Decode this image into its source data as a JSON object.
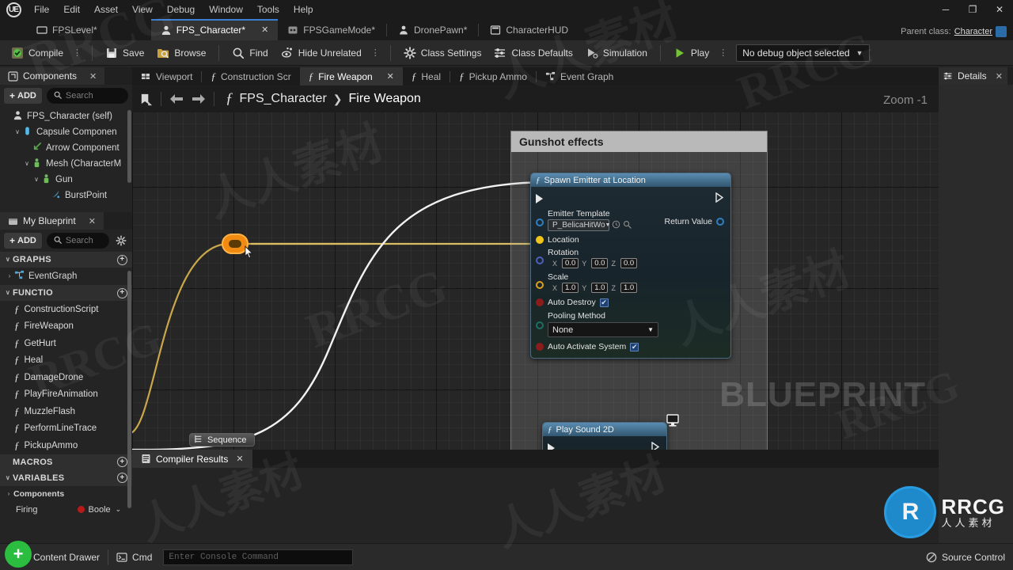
{
  "app": {
    "logo_text": "UE",
    "menu": [
      "File",
      "Edit",
      "Asset",
      "View",
      "Debug",
      "Window",
      "Tools",
      "Help"
    ],
    "window_controls": {
      "minimize": "─",
      "maximize": "❐",
      "close": "✕"
    }
  },
  "asset_tabs": [
    {
      "label": "FPSLevel*",
      "icon": "level-icon",
      "active": false,
      "closeable": false
    },
    {
      "label": "FPS_Character*",
      "icon": "character-icon",
      "active": true,
      "closeable": true,
      "close": "✕"
    },
    {
      "label": "FPSGameMode*",
      "icon": "gamemode-icon",
      "active": false,
      "closeable": false
    },
    {
      "label": "DronePawn*",
      "icon": "pawn-icon",
      "active": false,
      "closeable": false
    },
    {
      "label": "CharacterHUD",
      "icon": "hud-icon",
      "active": false,
      "closeable": false
    }
  ],
  "parent_class": {
    "label": "Parent class:",
    "value": "Character"
  },
  "toolbar": {
    "compile": "Compile",
    "save": "Save",
    "browse": "Browse",
    "find": "Find",
    "hide_unrelated": "Hide Unrelated",
    "class_settings": "Class Settings",
    "class_defaults": "Class Defaults",
    "simulation": "Simulation",
    "play": "Play",
    "debug_object": "No debug object selected",
    "overflow_dots": "⋮"
  },
  "components_panel": {
    "tab_label": "Components",
    "tab_close": "✕",
    "add_label": "ADD",
    "search_placeholder": "Search",
    "tree": [
      {
        "label": "FPS_Character (self)",
        "indent": 0,
        "twisty": "",
        "icon": "character-icon"
      },
      {
        "label": "Capsule Componen",
        "indent": 1,
        "twisty": "∨",
        "icon": "capsule-icon"
      },
      {
        "label": "Arrow Component",
        "indent": 2,
        "twisty": "",
        "icon": "arrow-icon"
      },
      {
        "label": "Mesh (CharacterM",
        "indent": 2,
        "twisty": "∨",
        "icon": "mesh-icon"
      },
      {
        "label": "Gun",
        "indent": 3,
        "twisty": "∨",
        "icon": "mesh-icon"
      },
      {
        "label": "BurstPoint",
        "indent": 4,
        "twisty": "",
        "icon": "particle-icon"
      }
    ]
  },
  "myblueprint_panel": {
    "tab_label": "My Blueprint",
    "tab_close": "✕",
    "add_label": "ADD",
    "search_placeholder": "Search",
    "gear_icon": "⚙",
    "sections": {
      "graphs": {
        "title": "GRAPHS",
        "add": "+",
        "twisty": "∨",
        "items": [
          {
            "label": "EventGraph",
            "twisty": "›",
            "icon": "graph-icon"
          }
        ]
      },
      "functions": {
        "title": "FUNCTIO",
        "add": "+",
        "twisty": "∨",
        "items": [
          "ConstructionScript",
          "FireWeapon",
          "GetHurt",
          "Heal",
          "DamageDrone",
          "PlayFireAnimation",
          "MuzzleFlash",
          "PerformLineTrace",
          "PickupAmmo"
        ]
      },
      "macros": {
        "title": "MACROS",
        "add": "+",
        "twisty": ""
      },
      "variables": {
        "title": "VARIABLES",
        "add": "+",
        "twisty": "∨",
        "items": [
          {
            "label": "Components",
            "twisty": "›",
            "type": ""
          },
          {
            "label": "Firing",
            "twisty": "",
            "type": "Boole"
          }
        ]
      }
    }
  },
  "graph_tabs": [
    {
      "label": "Viewport",
      "icon": "viewport-icon",
      "active": false
    },
    {
      "label": "Construction Scr",
      "icon": "function-icon",
      "active": false
    },
    {
      "label": "Fire Weapon",
      "icon": "function-icon",
      "active": true,
      "close": "✕"
    },
    {
      "label": "Heal",
      "icon": "function-icon",
      "active": false
    },
    {
      "label": "Pickup Ammo",
      "icon": "function-icon",
      "active": false
    },
    {
      "label": "Event Graph",
      "icon": "graph-icon",
      "active": false
    }
  ],
  "graph": {
    "breadcrumb": {
      "root": "FPS_Character",
      "sep": "❯",
      "current": "Fire Weapon",
      "fn_icon": "function-icon"
    },
    "nav_back": "←",
    "nav_forward": "→",
    "bookmark_icon": "bookmark-icon",
    "zoom_label": "Zoom -1",
    "watermark": "BLUEPRINT",
    "comment": {
      "title": "Gunshot effects"
    },
    "nodes": {
      "spawn_emitter": {
        "title": "Spawn Emitter at Location",
        "pins": {
          "emitter_template_label": "Emitter Template",
          "emitter_template_value": "P_BelicaHitWo",
          "location_label": "Location",
          "rotation_label": "Rotation",
          "rotation": {
            "x_label": "X",
            "x": "0.0",
            "y_label": "Y",
            "y": "0.0",
            "z_label": "Z",
            "z": "0.0"
          },
          "scale_label": "Scale",
          "scale": {
            "x_label": "X",
            "x": "1.0",
            "y_label": "Y",
            "y": "1.0",
            "z_label": "Z",
            "z": "1.0"
          },
          "auto_destroy_label": "Auto Destroy",
          "auto_destroy_checked": "✔",
          "pooling_method_label": "Pooling Method",
          "pooling_method_value": "None",
          "auto_activate_label": "Auto Activate System",
          "auto_activate_checked": "✔",
          "return_value_label": "Return Value"
        }
      },
      "sequence": {
        "title": "Sequence"
      },
      "play_sound": {
        "title": "Play Sound 2D"
      }
    }
  },
  "compiler_results": {
    "tab_label": "Compiler Results",
    "tab_close": "✕"
  },
  "details_panel": {
    "tab_label": "Details",
    "tab_close": "✕"
  },
  "status_bar": {
    "content_drawer": "Content Drawer",
    "cmd": "Cmd",
    "console_placeholder": "Enter Console Command",
    "source_control": "Source Control"
  },
  "branding": {
    "mark": "RRCG",
    "sub": "人人素材",
    "monogram": "R"
  },
  "colors": {
    "accent_blue": "#3b7fd4",
    "exec_white": "#e8e8e8",
    "object_blue": "#2f7fc4",
    "vector_yellow": "#f0c419",
    "bool_red": "#8c1c1c",
    "knot_orange": "#f08a10",
    "compile_green": "#55c24a",
    "play_green": "#73c431"
  }
}
